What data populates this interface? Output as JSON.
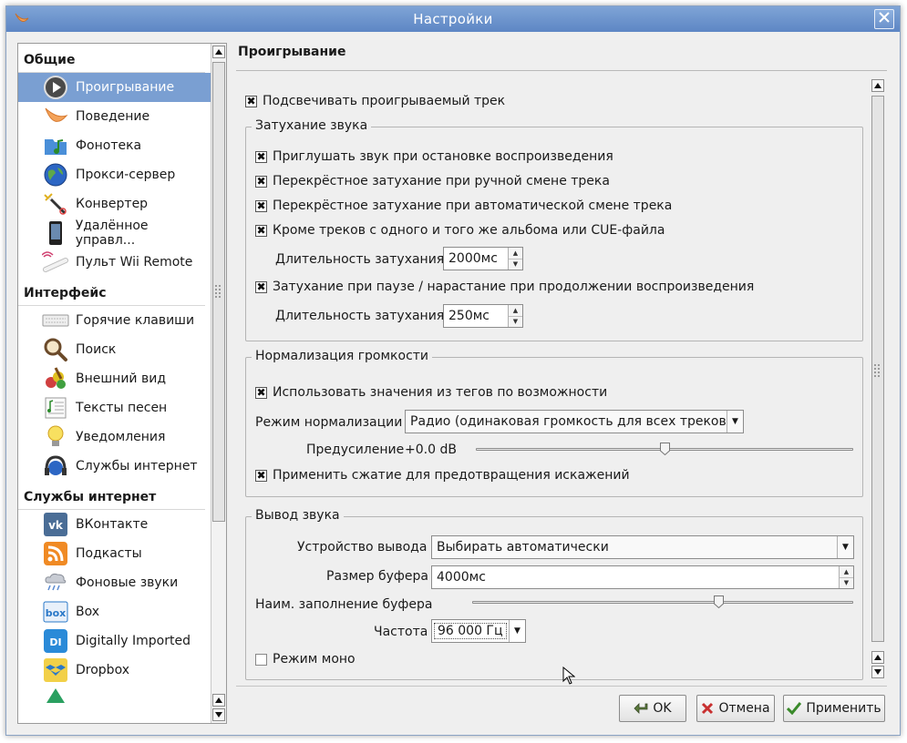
{
  "window": {
    "title": "Настройки"
  },
  "sidebar": {
    "categories": [
      {
        "label": "Общие",
        "items": [
          {
            "label": "Проигрывание",
            "icon": "play-icon",
            "selected": true
          },
          {
            "label": "Поведение",
            "icon": "clementine-icon"
          },
          {
            "label": "Фонотека",
            "icon": "music-folder-icon"
          },
          {
            "label": "Прокси-сервер",
            "icon": "globe-icon"
          },
          {
            "label": "Конвертер",
            "icon": "magic-wand-icon"
          },
          {
            "label": "Удалённое управл...",
            "icon": "phone-icon"
          },
          {
            "label": "Пульт Wii Remote",
            "icon": "wii-remote-icon"
          }
        ]
      },
      {
        "label": "Интерфейс",
        "items": [
          {
            "label": "Горячие клавиши",
            "icon": "keyboard-icon"
          },
          {
            "label": "Поиск",
            "icon": "magnifier-icon"
          },
          {
            "label": "Внешний вид",
            "icon": "paint-icon"
          },
          {
            "label": "Тексты песен",
            "icon": "lyrics-icon"
          },
          {
            "label": "Уведомления",
            "icon": "lightbulb-icon"
          },
          {
            "label": "Службы интернет",
            "icon": "headphones-globe-icon"
          }
        ]
      },
      {
        "label": "Службы интернет",
        "items": [
          {
            "label": "ВКонтакте",
            "icon": "vk-icon"
          },
          {
            "label": "Подкасты",
            "icon": "rss-icon"
          },
          {
            "label": "Фоновые звуки",
            "icon": "cloud-rain-icon"
          },
          {
            "label": "Box",
            "icon": "box-icon"
          },
          {
            "label": "Digitally Imported",
            "icon": "di-icon"
          },
          {
            "label": "Dropbox",
            "icon": "dropbox-icon"
          }
        ]
      }
    ]
  },
  "main": {
    "title": "Проигрывание",
    "highlight_track": {
      "label": "Подсвечивать проигрываемый трек",
      "checked": true
    },
    "fade": {
      "title": "Затухание звука",
      "mute_on_stop": {
        "label": "Приглушать звук при остановке воспроизведения",
        "checked": true
      },
      "crossfade_manual": {
        "label": "Перекрёстное затухание при ручной смене трека",
        "checked": true
      },
      "crossfade_auto": {
        "label": "Перекрёстное затухание при автоматической смене трека",
        "checked": true
      },
      "except_same_album": {
        "label": "Кроме треков с одного и того же альбома или CUE-файла",
        "checked": true
      },
      "duration_label": "Длительность затухания",
      "duration_value": "2000мс",
      "fade_on_pause": {
        "label": "Затухание при паузе / нарастание при продолжении воспроизведения",
        "checked": true
      },
      "pause_duration_label": "Длительность затухания",
      "pause_duration_value": "250мс"
    },
    "normalization": {
      "title": "Нормализация громкости",
      "use_tags": {
        "label": "Использовать значения из тегов по возможности",
        "checked": true
      },
      "mode_label": "Режим нормализации",
      "mode_value": "Радио (одинаковая громкость для всех треков)",
      "preamp_label": "Предусиление",
      "preamp_value": "+0.0 dB",
      "preamp_fraction": 0.5,
      "compression": {
        "label": "Применить сжатие для предотвращения искажений",
        "checked": true
      }
    },
    "output": {
      "title": "Вывод звука",
      "device_label": "Устройство вывода",
      "device_value": "Выбирать автоматически",
      "buffer_label": "Размер буфера",
      "buffer_value": "4000мс",
      "min_fill_label": "Наим. заполнение буфера",
      "min_fill_fraction": 0.65,
      "rate_label": "Частота",
      "rate_value": "96 000 Гц",
      "mono": {
        "label": "Режим моно",
        "checked": false
      }
    }
  },
  "buttons": {
    "ok": "OK",
    "cancel": "Отмена",
    "apply": "Применить"
  },
  "colors": {
    "titlebar": "#6f96cf",
    "selection": "#7a9fd2"
  }
}
